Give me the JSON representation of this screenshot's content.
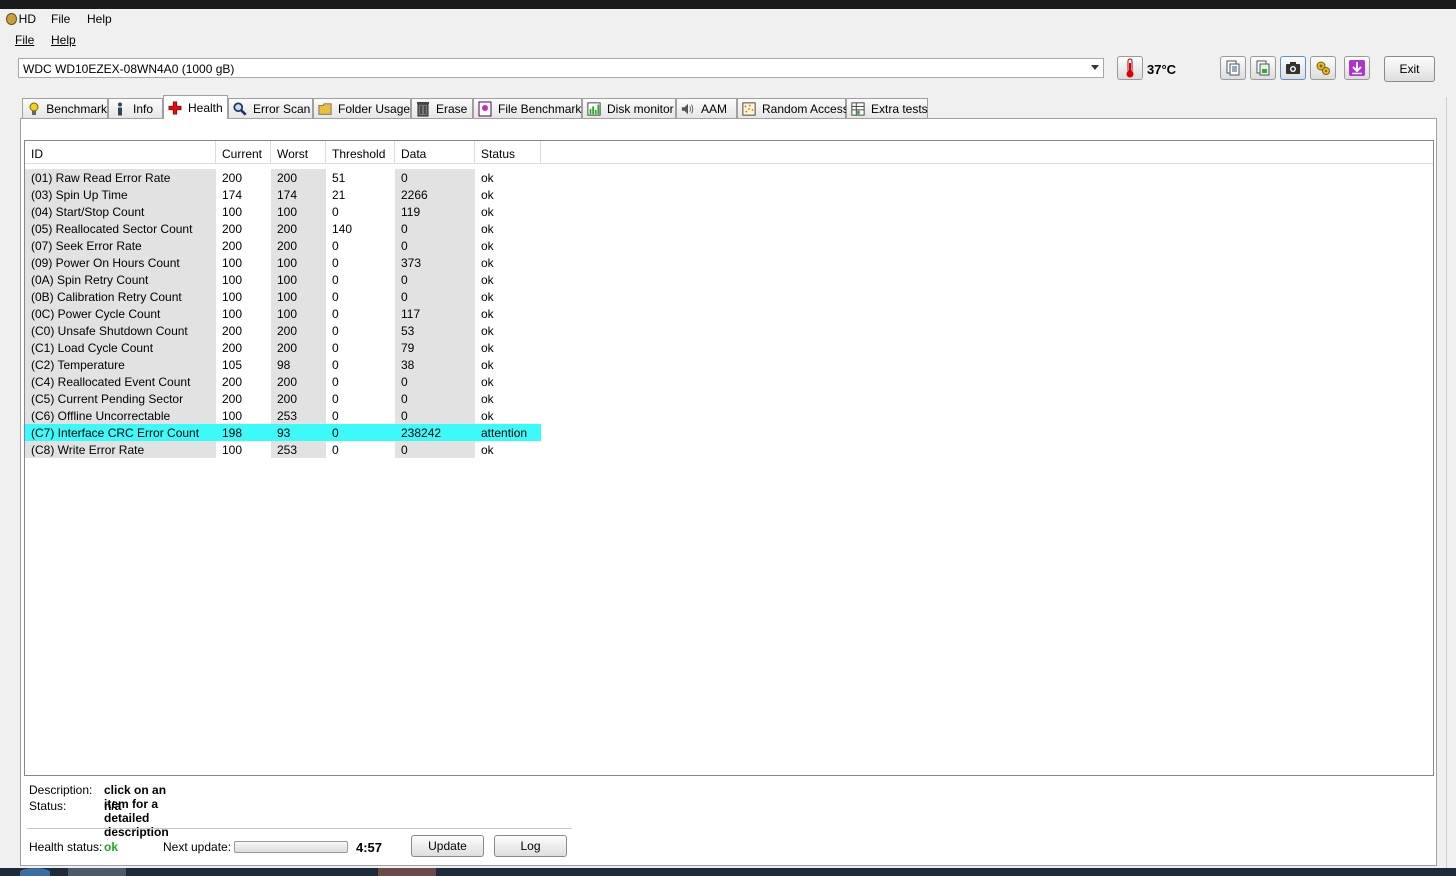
{
  "title_menu": {
    "app_abbr": "HD",
    "items": [
      "File",
      "Help"
    ]
  },
  "menubar": {
    "items": [
      "File",
      "Help"
    ]
  },
  "toolbar": {
    "drive": "WDC WD10EZEX-08WN4A0 (1000 gB)",
    "temperature": "37°C",
    "exit_label": "Exit",
    "icons": [
      "thermometer-icon",
      "copy-text-icon",
      "copy-image-icon",
      "screenshot-icon",
      "options-icon",
      "save-icon"
    ]
  },
  "tabs": [
    {
      "label": "Benchmark",
      "icon": "lightbulb-icon",
      "active": false
    },
    {
      "label": "Info",
      "icon": "info-icon",
      "active": false
    },
    {
      "label": "Health",
      "icon": "health-cross-icon",
      "active": true
    },
    {
      "label": "Error Scan",
      "icon": "magnifier-icon",
      "active": false
    },
    {
      "label": "Folder Usage",
      "icon": "folder-icon",
      "active": false
    },
    {
      "label": "Erase",
      "icon": "trash-icon",
      "active": false
    },
    {
      "label": "File Benchmark",
      "icon": "file-benchmark-icon",
      "active": false
    },
    {
      "label": "Disk monitor",
      "icon": "disk-monitor-icon",
      "active": false
    },
    {
      "label": "AAM",
      "icon": "speaker-icon",
      "active": false
    },
    {
      "label": "Random Access",
      "icon": "random-access-icon",
      "active": false
    },
    {
      "label": "Extra tests",
      "icon": "extra-tests-icon",
      "active": false
    }
  ],
  "smart": {
    "columns": [
      "ID",
      "Current",
      "Worst",
      "Threshold",
      "Data",
      "Status"
    ],
    "rows": [
      {
        "id": "(01) Raw Read Error Rate",
        "current": "200",
        "worst": "200",
        "threshold": "51",
        "data": "0",
        "status": "ok"
      },
      {
        "id": "(03) Spin Up Time",
        "current": "174",
        "worst": "174",
        "threshold": "21",
        "data": "2266",
        "status": "ok"
      },
      {
        "id": "(04) Start/Stop Count",
        "current": "100",
        "worst": "100",
        "threshold": "0",
        "data": "119",
        "status": "ok"
      },
      {
        "id": "(05) Reallocated Sector Count",
        "current": "200",
        "worst": "200",
        "threshold": "140",
        "data": "0",
        "status": "ok"
      },
      {
        "id": "(07) Seek Error Rate",
        "current": "200",
        "worst": "200",
        "threshold": "0",
        "data": "0",
        "status": "ok"
      },
      {
        "id": "(09) Power On Hours Count",
        "current": "100",
        "worst": "100",
        "threshold": "0",
        "data": "373",
        "status": "ok"
      },
      {
        "id": "(0A) Spin Retry Count",
        "current": "100",
        "worst": "100",
        "threshold": "0",
        "data": "0",
        "status": "ok"
      },
      {
        "id": "(0B) Calibration Retry Count",
        "current": "100",
        "worst": "100",
        "threshold": "0",
        "data": "0",
        "status": "ok"
      },
      {
        "id": "(0C) Power Cycle Count",
        "current": "100",
        "worst": "100",
        "threshold": "0",
        "data": "117",
        "status": "ok"
      },
      {
        "id": "(C0) Unsafe Shutdown Count",
        "current": "200",
        "worst": "200",
        "threshold": "0",
        "data": "53",
        "status": "ok"
      },
      {
        "id": "(C1) Load Cycle Count",
        "current": "200",
        "worst": "200",
        "threshold": "0",
        "data": "79",
        "status": "ok"
      },
      {
        "id": "(C2) Temperature",
        "current": "105",
        "worst": "98",
        "threshold": "0",
        "data": "38",
        "status": "ok"
      },
      {
        "id": "(C4) Reallocated Event Count",
        "current": "200",
        "worst": "200",
        "threshold": "0",
        "data": "0",
        "status": "ok"
      },
      {
        "id": "(C5) Current Pending Sector",
        "current": "200",
        "worst": "200",
        "threshold": "0",
        "data": "0",
        "status": "ok"
      },
      {
        "id": "(C6) Offline Uncorrectable",
        "current": "100",
        "worst": "253",
        "threshold": "0",
        "data": "0",
        "status": "ok"
      },
      {
        "id": "(C7) Interface CRC Error Count",
        "current": "198",
        "worst": "93",
        "threshold": "0",
        "data": "238242",
        "status": "attention",
        "highlight": true
      },
      {
        "id": "(C8) Write Error Rate",
        "current": "100",
        "worst": "253",
        "threshold": "0",
        "data": "0",
        "status": "ok"
      }
    ]
  },
  "details": {
    "description_label": "Description:",
    "description_value": "click on an item for a detailed description",
    "status_label": "Status:",
    "status_value": "n/a"
  },
  "footer": {
    "health_label": "Health status:",
    "health_value": "ok",
    "next_update_label": "Next update:",
    "countdown": "4:57",
    "update_label": "Update",
    "log_label": "Log",
    "progress_fraction": 0.0
  },
  "colors": {
    "highlight_row": "#3cfafa",
    "health_ok": "#1fa81f"
  }
}
